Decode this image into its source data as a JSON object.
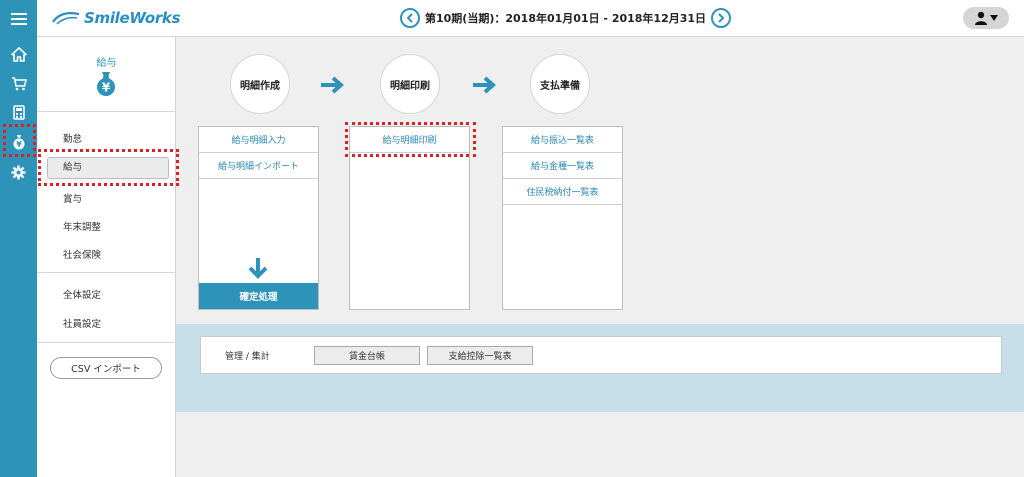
{
  "app": {
    "logo_text": "SmileWorks"
  },
  "header": {
    "period": "第10期(当期)：2018年01月01日 - 2018年12月31日"
  },
  "rail": {
    "icons": [
      "home-icon",
      "cart-icon",
      "calculator-icon",
      "money-bag-icon",
      "gear-icon"
    ]
  },
  "sidebar": {
    "title": "給与",
    "items": [
      {
        "label": "勤怠"
      },
      {
        "label": "給与"
      },
      {
        "label": "賞与"
      },
      {
        "label": "年末調整"
      },
      {
        "label": "社会保険"
      },
      {
        "label": "全体設定"
      },
      {
        "label": "社員設定"
      }
    ],
    "csv_button": "CSV インポート"
  },
  "flow": {
    "steps": [
      {
        "label": "明細作成"
      },
      {
        "label": "明細印刷"
      },
      {
        "label": "支払準備"
      }
    ],
    "col1": {
      "items": [
        "給与明細入力",
        "給与明細インポート"
      ],
      "confirm": "確定処理"
    },
    "col2": {
      "items": [
        "給与明細印刷"
      ]
    },
    "col3": {
      "items": [
        "給与振込一覧表",
        "給与金種一覧表",
        "住民税納付一覧表"
      ]
    }
  },
  "management": {
    "label": "管理 / 集計",
    "buttons": [
      "賃金台帳",
      "支給控除一覧表"
    ]
  },
  "colors": {
    "accent": "#2e93b9",
    "highlight": "#e02020"
  }
}
